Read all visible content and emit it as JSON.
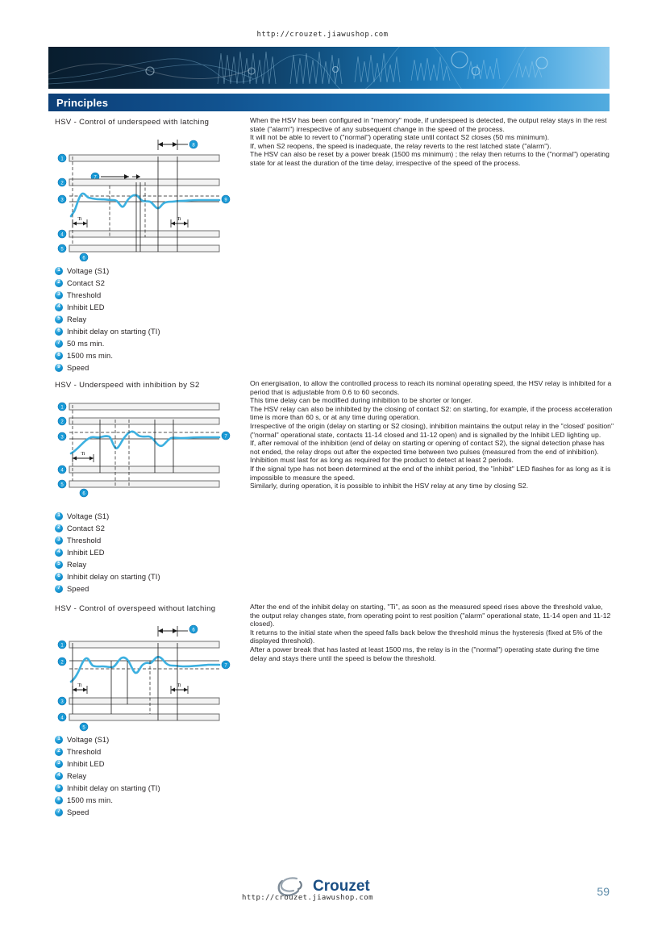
{
  "header": {
    "url": "http://crouzet.jiawushop.com"
  },
  "title_bar": {
    "label": "Principles"
  },
  "sections": [
    {
      "heading": "HSV - Control of underspeed with latching",
      "body": "When the HSV has been configured in \"memory\" mode, if underspeed is detected, the output relay stays in the rest state (\"alarm\") irrespective of any subsequent change in the speed of the process.\nIt will not be able to revert to (\"normal\") operating state until contact S2 closes (50 ms minimum).\nIf, when S2 reopens, the speed is inadequate, the relay reverts to the rest latched state (\"alarm\").\nThe HSV can also be reset by a power break (1500 ms minimum) ; the relay then returns to the (\"normal\") operating state for at least the duration of the time delay, irrespective of the speed of the process.",
      "legend": [
        {
          "num": "1",
          "label": "Voltage (S1)"
        },
        {
          "num": "2",
          "label": "Contact S2"
        },
        {
          "num": "3",
          "label": "Threshold"
        },
        {
          "num": "4",
          "label": "Inhibit LED"
        },
        {
          "num": "5",
          "label": "Relay"
        },
        {
          "num": "6",
          "label": "Inhibit delay on starting (TI)"
        },
        {
          "num": "7",
          "label": "50 ms min."
        },
        {
          "num": "8",
          "label": "1500 ms min."
        },
        {
          "num": "9",
          "label": "Speed"
        }
      ]
    },
    {
      "heading": "HSV - Underspeed with inhibition by S2",
      "body": "On energisation, to allow the controlled process to reach its nominal operating speed, the HSV relay is inhibited for a period that is adjustable from 0.6 to 60 seconds.\nThis time delay can be modified during inhibition to be shorter or longer.\nThe HSV relay can also be inhibited by the closing of contact S2: on starting, for example, if the process acceleration time is more than 60 s, or at any time during operation.\nIrrespective of the origin (delay on starting or S2 closing), inhibition maintains the output relay in the \"closed' position\" (\"normal\" operational state, contacts 11-14 closed and 11-12 open) and is signalled by the Inhibit LED lighting up.\nIf, after removal of the inhibition (end of delay on starting or opening of contact S2), the signal detection phase has not ended, the relay drops out after the expected time between two pulses (measured from the end of inhibition).\nInhibition must last for as long as required for the product to detect at least 2 periods.\nIf the signal type has not been determined at the end of the inhibit period, the \"inhibit\" LED flashes for as long as it is impossible to measure the speed.\nSimilarly, during operation, it is possible to inhibit the HSV relay at any time by closing S2.",
      "legend": [
        {
          "num": "1",
          "label": "Voltage (S1)"
        },
        {
          "num": "2",
          "label": "Contact S2"
        },
        {
          "num": "3",
          "label": "Threshold"
        },
        {
          "num": "4",
          "label": "Inhibit LED"
        },
        {
          "num": "5",
          "label": "Relay"
        },
        {
          "num": "6",
          "label": "Inhibit delay on starting (TI)"
        },
        {
          "num": "7",
          "label": "Speed"
        }
      ]
    },
    {
      "heading": "HSV - Control of overspeed without latching",
      "body": "After the end of the inhibit delay on starting, \"Ti\", as soon as the measured speed rises above the threshold value, the output relay changes state, from operating point to rest position (\"alarm\" operational state, 11-14 open and 11-12 closed).\nIt returns to the initial state when the speed falls back below the threshold minus the hysteresis (fixed at 5% of the displayed threshold).\nAfter a power break that has lasted at least 1500 ms, the relay is in the (\"normal\") operating state during the time delay and stays there until the speed is below the threshold.",
      "legend": [
        {
          "num": "1",
          "label": "Voltage (S1)"
        },
        {
          "num": "2",
          "label": "Threshold"
        },
        {
          "num": "3",
          "label": "Inhibit LED"
        },
        {
          "num": "4",
          "label": "Relay"
        },
        {
          "num": "5",
          "label": "Inhibit delay on starting (TI)"
        },
        {
          "num": "6",
          "label": "1500 ms min."
        },
        {
          "num": "7",
          "label": "Speed"
        }
      ]
    }
  ],
  "footer": {
    "brand": "Crouzet",
    "url": "http://crouzet.jiawushop.com",
    "page_number": "59"
  },
  "colors": {
    "accent_blue": "#199ad6",
    "signal_blue": "#3cb0e0",
    "banner_dark": "#081d2e",
    "title_bar_blue": "#11528f",
    "page_number": "#5b8aa8"
  }
}
